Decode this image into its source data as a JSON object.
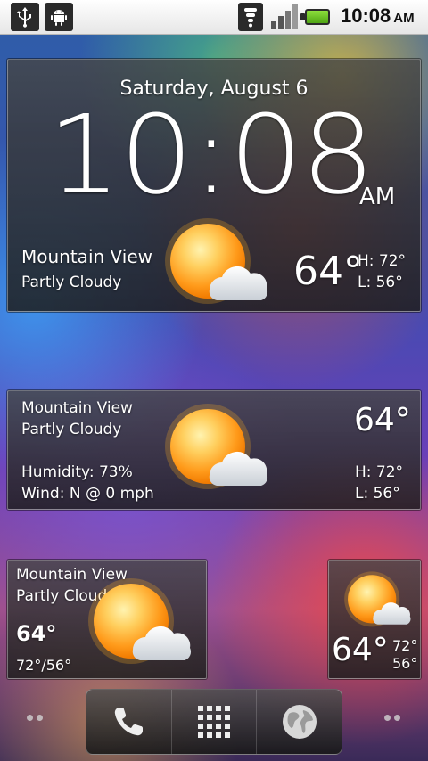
{
  "status_bar": {
    "time": "10:08",
    "ampm": "AM",
    "icons": [
      "usb-icon",
      "android-debug-icon",
      "wifi-icon",
      "signal-icon",
      "battery-icon"
    ],
    "battery_color": "#6cc627"
  },
  "clock_widget": {
    "date": "Saturday, August 6",
    "time": "10:08",
    "ampm": "AM",
    "city": "Mountain View",
    "condition": "Partly Cloudy",
    "temp": "64°",
    "high": "H:  72°",
    "low": "L:  56°",
    "icon": "partly-cloudy-icon"
  },
  "weather_wide": {
    "city": "Mountain View",
    "condition": "Partly Cloudy",
    "temp": "64°",
    "humidity": "Humidity: 73%",
    "wind": "Wind: N @ 0 mph",
    "high": "H:  72°",
    "low": "L:  56°",
    "icon": "partly-cloudy-icon"
  },
  "weather_medium": {
    "city": "Mountain View",
    "condition": "Partly Cloudy",
    "temp": "64°",
    "range": "72°/56°",
    "icon": "partly-cloudy-icon"
  },
  "weather_small": {
    "temp": "64°",
    "high": "72°",
    "low": "56°",
    "icon": "partly-cloudy-icon"
  },
  "dock": {
    "buttons": [
      "phone-icon",
      "app-drawer-icon",
      "browser-globe-icon"
    ]
  }
}
